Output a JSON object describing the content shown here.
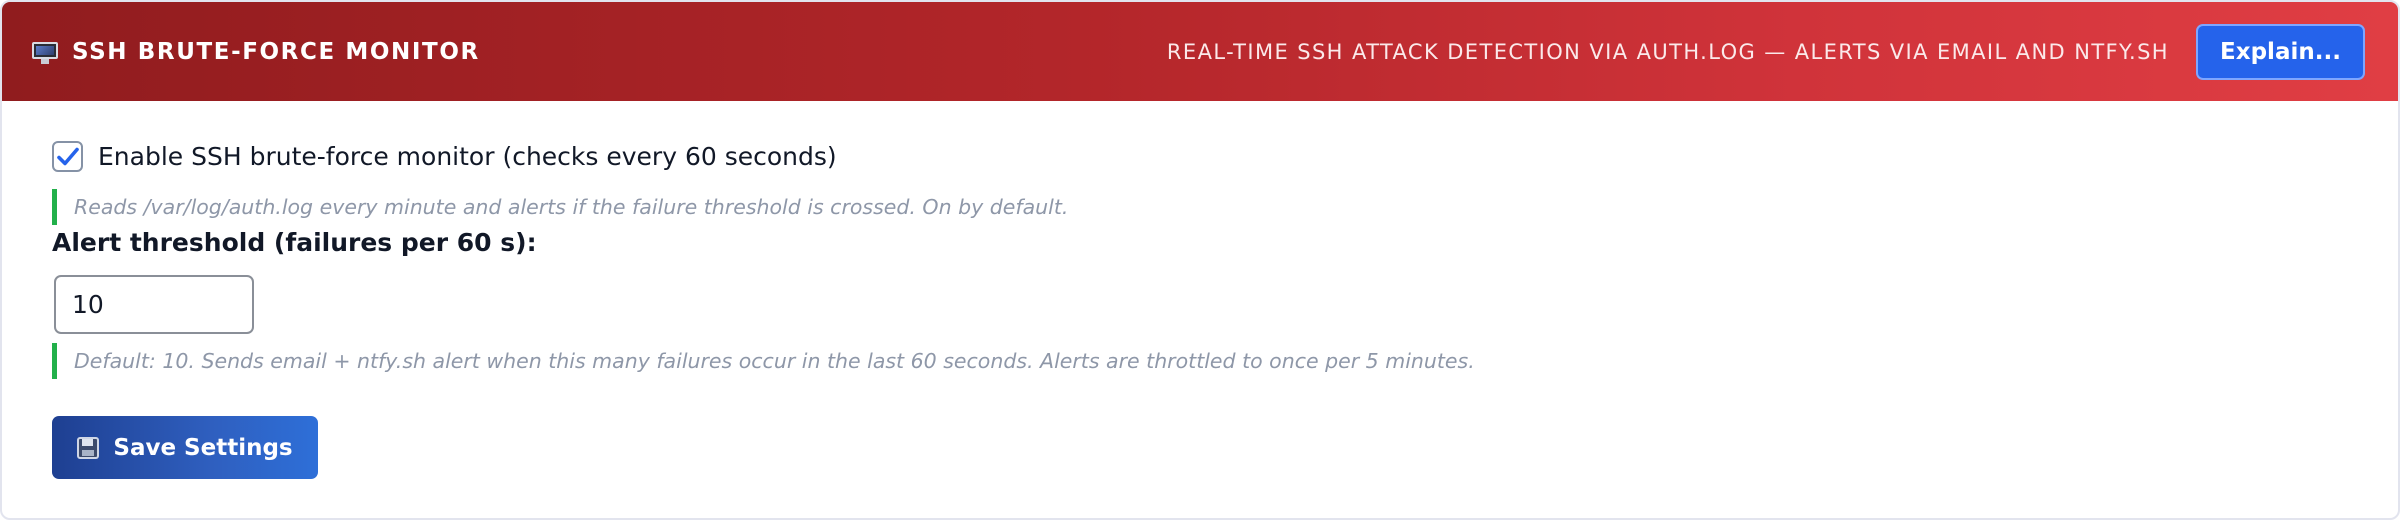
{
  "header": {
    "icon": "monitor-icon",
    "title": "SSH BRUTE-FORCE MONITOR",
    "subtitle": "REAL-TIME SSH ATTACK DETECTION VIA AUTH.LOG — ALERTS VIA EMAIL AND NTFY.SH",
    "explain_label": "Explain...",
    "colors": {
      "gradient_start": "#901c1e",
      "gradient_end": "#e03e44",
      "explain_button": "#2563eb"
    }
  },
  "monitor": {
    "enabled": true,
    "checkbox_label": "Enable SSH brute-force monitor (checks every 60 seconds)",
    "hint": "Reads /var/log/auth.log every minute and alerts if the failure threshold is crossed. On by default."
  },
  "threshold": {
    "label": "Alert threshold (failures per 60 s):",
    "value": "10",
    "hint": "Default: 10. Sends email + ntfy.sh alert when this many failures occur in the last 60 seconds. Alerts are throttled to once per 5 minutes."
  },
  "actions": {
    "save_icon": "floppy-disk-icon",
    "save_label": "Save Settings"
  },
  "colors": {
    "hint_bar": "#22b04a",
    "checkbox_check": "#2563eb"
  }
}
